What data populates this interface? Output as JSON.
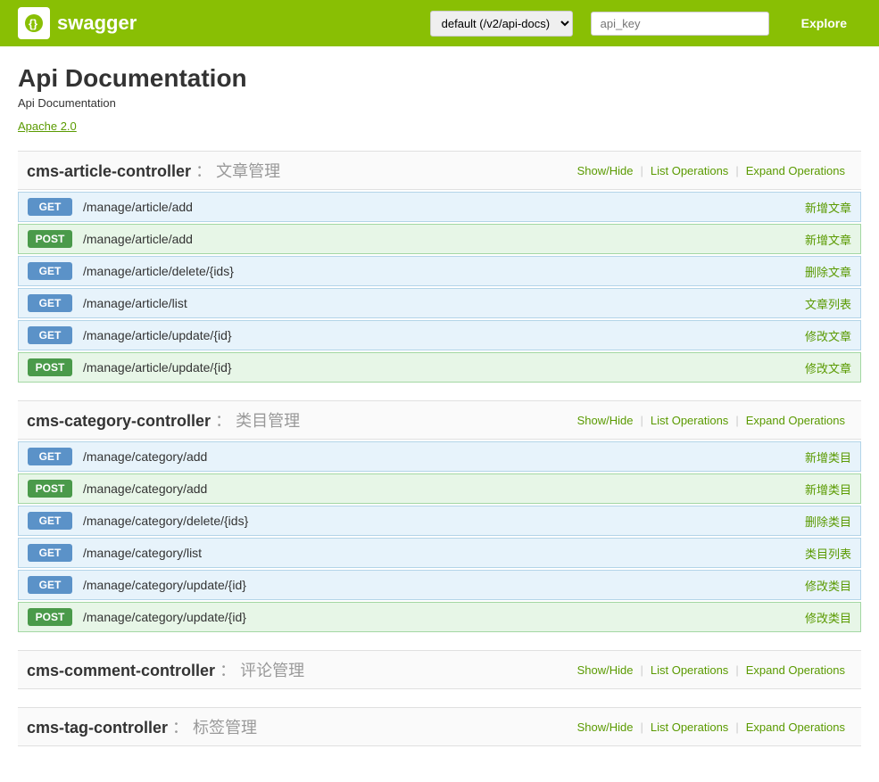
{
  "header": {
    "logo_text": "swagger",
    "logo_icon": "S",
    "select_value": "default (/v2/api-docs)",
    "api_key_placeholder": "api_key",
    "explore_label": "Explore"
  },
  "page": {
    "title": "Api Documentation",
    "subtitle": "Api Documentation",
    "apache_link": "Apache 2.0"
  },
  "controllers": [
    {
      "id": "cms-article-controller",
      "name": "cms-article-controller",
      "separator": "：",
      "desc": "文章管理",
      "show_hide": "Show/Hide",
      "list_ops": "List Operations",
      "expand_ops": "Expand Operations",
      "operations": [
        {
          "method": "GET",
          "path": "/manage/article/add",
          "desc": "新增文章"
        },
        {
          "method": "POST",
          "path": "/manage/article/add",
          "desc": "新增文章"
        },
        {
          "method": "GET",
          "path": "/manage/article/delete/{ids}",
          "desc": "删除文章"
        },
        {
          "method": "GET",
          "path": "/manage/article/list",
          "desc": "文章列表"
        },
        {
          "method": "GET",
          "path": "/manage/article/update/{id}",
          "desc": "修改文章"
        },
        {
          "method": "POST",
          "path": "/manage/article/update/{id}",
          "desc": "修改文章"
        }
      ]
    },
    {
      "id": "cms-category-controller",
      "name": "cms-category-controller",
      "separator": "：",
      "desc": "类目管理",
      "show_hide": "Show/Hide",
      "list_ops": "List Operations",
      "expand_ops": "Expand Operations",
      "operations": [
        {
          "method": "GET",
          "path": "/manage/category/add",
          "desc": "新增类目"
        },
        {
          "method": "POST",
          "path": "/manage/category/add",
          "desc": "新增类目"
        },
        {
          "method": "GET",
          "path": "/manage/category/delete/{ids}",
          "desc": "删除类目"
        },
        {
          "method": "GET",
          "path": "/manage/category/list",
          "desc": "类目列表"
        },
        {
          "method": "GET",
          "path": "/manage/category/update/{id}",
          "desc": "修改类目"
        },
        {
          "method": "POST",
          "path": "/manage/category/update/{id}",
          "desc": "修改类目"
        }
      ]
    },
    {
      "id": "cms-comment-controller",
      "name": "cms-comment-controller",
      "separator": "：",
      "desc": "评论管理",
      "show_hide": "Show/Hide",
      "list_ops": "List Operations",
      "expand_ops": "Expand Operations",
      "operations": []
    },
    {
      "id": "cms-tag-controller",
      "name": "cms-tag-controller",
      "separator": "：",
      "desc": "标签管理",
      "show_hide": "Show/Hide",
      "list_ops": "List Operations",
      "expand_ops": "Expand Operations",
      "operations": []
    }
  ]
}
